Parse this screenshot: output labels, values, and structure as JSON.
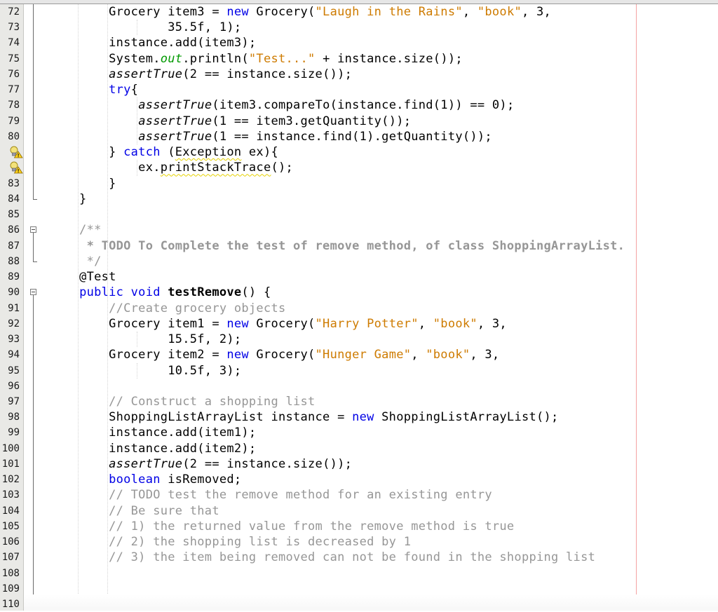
{
  "editor": {
    "language": "java",
    "colors": {
      "keyword": "#0000e6",
      "string": "#ce7b00",
      "comment": "#969696",
      "margin_line": "#f4a3a3"
    },
    "lines": [
      {
        "number": "72",
        "segments": [
          {
            "t": "        Grocery item3 = "
          },
          {
            "t": "new",
            "c": "kw"
          },
          {
            "t": " Grocery("
          },
          {
            "t": "\"Laugh in the Rains\"",
            "c": "str"
          },
          {
            "t": ", "
          },
          {
            "t": "\"book\"",
            "c": "str"
          },
          {
            "t": ", 3,"
          }
        ]
      },
      {
        "number": "73",
        "segments": [
          {
            "t": "                35.5f, 1);"
          }
        ]
      },
      {
        "number": "74",
        "segments": [
          {
            "t": "        instance.add(item3);"
          }
        ]
      },
      {
        "number": "75",
        "segments": [
          {
            "t": "        System."
          },
          {
            "t": "out",
            "c": "itkw"
          },
          {
            "t": ".println("
          },
          {
            "t": "\"Test...\"",
            "c": "str"
          },
          {
            "t": " + instance.size());"
          }
        ]
      },
      {
        "number": "76",
        "segments": [
          {
            "t": "        "
          },
          {
            "t": "assertTrue",
            "c": "it"
          },
          {
            "t": "(2 == instance.size());"
          }
        ]
      },
      {
        "number": "77",
        "segments": [
          {
            "t": "        "
          },
          {
            "t": "try",
            "c": "kw"
          },
          {
            "t": "{"
          }
        ]
      },
      {
        "number": "78",
        "segments": [
          {
            "t": "            "
          },
          {
            "t": "assertTrue",
            "c": "it"
          },
          {
            "t": "(item3.compareTo(instance.find(1)) == 0);"
          }
        ]
      },
      {
        "number": "79",
        "segments": [
          {
            "t": "            "
          },
          {
            "t": "assertTrue",
            "c": "it"
          },
          {
            "t": "(1 == item3.getQuantity());"
          }
        ]
      },
      {
        "number": "80",
        "segments": [
          {
            "t": "            "
          },
          {
            "t": "assertTrue",
            "c": "it"
          },
          {
            "t": "(1 == instance.find(1).getQuantity());"
          }
        ]
      },
      {
        "number": "",
        "icon": "hint-warning-icon",
        "segments": [
          {
            "t": "        } "
          },
          {
            "t": "catch",
            "c": "kw"
          },
          {
            "t": " ("
          },
          {
            "t": "Exception",
            "c": "warn-ul"
          },
          {
            "t": " ex){"
          }
        ]
      },
      {
        "number": "",
        "icon": "hint-warning-icon",
        "segments": [
          {
            "t": "            ex."
          },
          {
            "t": "printStackTrace",
            "c": "warn-ul"
          },
          {
            "t": "();"
          }
        ]
      },
      {
        "number": "83",
        "segments": [
          {
            "t": "        }"
          }
        ]
      },
      {
        "number": "84",
        "segments": [
          {
            "t": "    }"
          }
        ]
      },
      {
        "number": "85",
        "segments": [
          {
            "t": ""
          }
        ]
      },
      {
        "number": "86",
        "segments": [
          {
            "t": "    /**",
            "c": "cmt"
          }
        ]
      },
      {
        "number": "87",
        "segments": [
          {
            "t": "     * TODO To Complete the test of remove method, of class ShoppingArrayList.",
            "c": "doc"
          }
        ]
      },
      {
        "number": "88",
        "segments": [
          {
            "t": "     */",
            "c": "cmt"
          }
        ]
      },
      {
        "number": "89",
        "segments": [
          {
            "t": "    @Test"
          }
        ]
      },
      {
        "number": "90",
        "segments": [
          {
            "t": "    "
          },
          {
            "t": "public",
            "c": "kw"
          },
          {
            "t": " "
          },
          {
            "t": "void",
            "c": "kw"
          },
          {
            "t": " "
          },
          {
            "t": "testRemove",
            "c": "bold"
          },
          {
            "t": "() {"
          }
        ]
      },
      {
        "number": "91",
        "segments": [
          {
            "t": "        //Create grocery objects",
            "c": "cmt"
          }
        ]
      },
      {
        "number": "92",
        "segments": [
          {
            "t": "        Grocery item1 = "
          },
          {
            "t": "new",
            "c": "kw"
          },
          {
            "t": " Grocery("
          },
          {
            "t": "\"Harry Potter\"",
            "c": "str"
          },
          {
            "t": ", "
          },
          {
            "t": "\"book\"",
            "c": "str"
          },
          {
            "t": ", 3,"
          }
        ]
      },
      {
        "number": "93",
        "segments": [
          {
            "t": "                15.5f, 2);"
          }
        ]
      },
      {
        "number": "94",
        "segments": [
          {
            "t": "        Grocery item2 = "
          },
          {
            "t": "new",
            "c": "kw"
          },
          {
            "t": " Grocery("
          },
          {
            "t": "\"Hunger Game\"",
            "c": "str"
          },
          {
            "t": ", "
          },
          {
            "t": "\"book\"",
            "c": "str"
          },
          {
            "t": ", 3,"
          }
        ]
      },
      {
        "number": "95",
        "segments": [
          {
            "t": "                10.5f, 3);"
          }
        ]
      },
      {
        "number": "96",
        "segments": [
          {
            "t": ""
          }
        ]
      },
      {
        "number": "97",
        "segments": [
          {
            "t": "        // Construct a shopping list",
            "c": "cmt"
          }
        ]
      },
      {
        "number": "98",
        "segments": [
          {
            "t": "        ShoppingListArrayList instance = "
          },
          {
            "t": "new",
            "c": "kw"
          },
          {
            "t": " ShoppingListArrayList();"
          }
        ]
      },
      {
        "number": "99",
        "segments": [
          {
            "t": "        instance.add(item1);"
          }
        ]
      },
      {
        "number": "100",
        "segments": [
          {
            "t": "        instance.add(item2);"
          }
        ]
      },
      {
        "number": "101",
        "segments": [
          {
            "t": "        "
          },
          {
            "t": "assertTrue",
            "c": "it"
          },
          {
            "t": "(2 == instance.size());"
          }
        ]
      },
      {
        "number": "102",
        "segments": [
          {
            "t": "        "
          },
          {
            "t": "boolean",
            "c": "kw"
          },
          {
            "t": " isRemoved;"
          }
        ]
      },
      {
        "number": "103",
        "segments": [
          {
            "t": "        // TODO test the remove method for an existing entry",
            "c": "cmt"
          }
        ]
      },
      {
        "number": "104",
        "segments": [
          {
            "t": "        // Be sure that",
            "c": "cmt"
          }
        ]
      },
      {
        "number": "105",
        "segments": [
          {
            "t": "        // 1) the returned value from the remove method is true",
            "c": "cmt"
          }
        ]
      },
      {
        "number": "106",
        "segments": [
          {
            "t": "        // 2) the shopping list is decreased by 1",
            "c": "cmt"
          }
        ]
      },
      {
        "number": "107",
        "segments": [
          {
            "t": "        // 3) the item being removed can not be found in the shopping list",
            "c": "cmt"
          }
        ]
      },
      {
        "number": "108",
        "segments": [
          {
            "t": ""
          }
        ]
      },
      {
        "number": "109",
        "segments": [
          {
            "t": ""
          }
        ]
      },
      {
        "number": "110",
        "segments": [
          {
            "t": ""
          }
        ]
      }
    ]
  }
}
